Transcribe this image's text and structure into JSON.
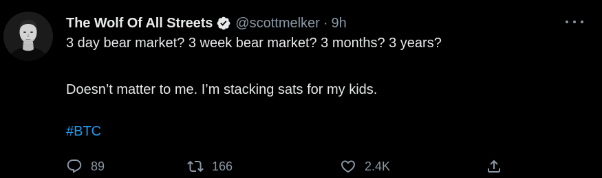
{
  "tweet": {
    "display_name": "The Wolf Of All Streets",
    "handle": "@scottmelker",
    "separator": "·",
    "time": "9h",
    "text_line1": "3 day bear market? 3 week bear market? 3 months? 3 years?",
    "text_line2": "Doesn’t matter to me. I’m stacking sats for my kids.",
    "hashtag": "#BTC",
    "verified": true
  },
  "actions": {
    "reply_count": "89",
    "retweet_count": "166",
    "like_count": "2.4K"
  },
  "icons": {
    "avatar": "avatar",
    "verified": "verified-badge-icon",
    "more": "more-icon",
    "reply": "reply-icon",
    "retweet": "retweet-icon",
    "like": "heart-icon",
    "share": "share-icon"
  },
  "colors": {
    "background": "#000000",
    "text": "#e7e9ea",
    "muted": "#8b98a5",
    "link": "#1d9bf0"
  }
}
